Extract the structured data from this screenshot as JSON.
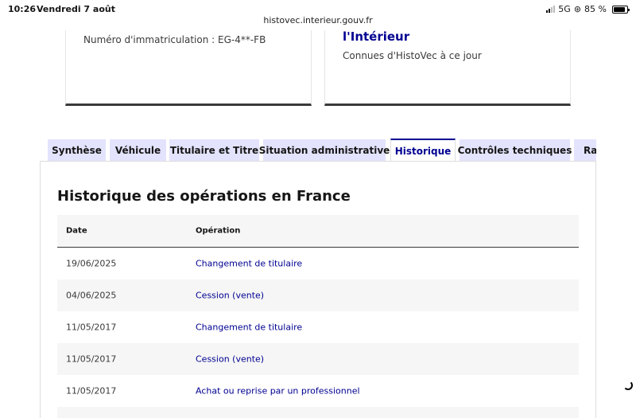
{
  "status_bar": {
    "time": "10:26",
    "date": "Vendredi 7 août",
    "network": "5G",
    "battery": "85 %",
    "battery_level": 0.85
  },
  "browser": {
    "url": "histovec.interieur.gouv.fr"
  },
  "cards": {
    "left": {
      "plate": "Numéro d'immatriculation : EG-4**-FB"
    },
    "right": {
      "title": "l'Intérieur",
      "description": "Connues d'HistoVec à ce jour"
    }
  },
  "tabs": [
    {
      "label": "Synthèse",
      "active": false
    },
    {
      "label": "Véhicule",
      "active": false
    },
    {
      "label": "Titulaire et Titre",
      "active": false
    },
    {
      "label": "Situation administrative",
      "active": false
    },
    {
      "label": "Historique",
      "active": true
    },
    {
      "label": "Contrôles techniques",
      "active": false
    },
    {
      "label": "Rap",
      "active": false
    }
  ],
  "history": {
    "title": "Historique des opérations en France",
    "columns": {
      "date": "Date",
      "operation": "Opération"
    },
    "rows": [
      {
        "date": "19/06/2025",
        "operation": "Changement de titulaire"
      },
      {
        "date": "04/06/2025",
        "operation": "Cession (vente)"
      },
      {
        "date": "11/05/2017",
        "operation": "Changement de titulaire"
      },
      {
        "date": "11/05/2017",
        "operation": "Cession (vente)"
      },
      {
        "date": "11/05/2017",
        "operation": "Achat ou reprise par un professionnel"
      }
    ]
  },
  "colors": {
    "primary": "#000091",
    "tab_bg": "#e3e3fd",
    "row_alt": "#f6f6f6",
    "card_border": "#3a3a3a"
  }
}
